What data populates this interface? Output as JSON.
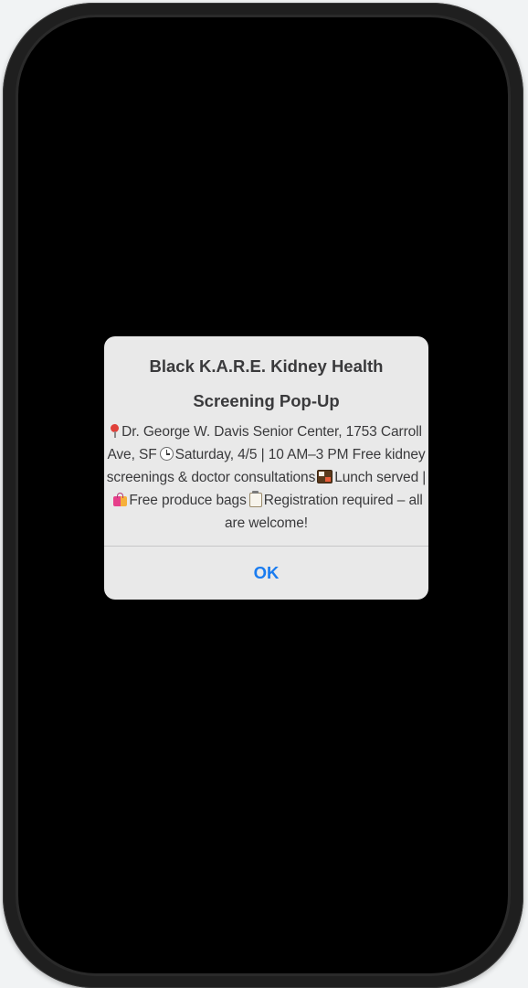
{
  "alert": {
    "title": "Black K.A.R.E. Kidney Health Screening Pop-Up",
    "message": {
      "location": "Dr. George W. Davis Senior Center, 1753 Carroll Ave, SF",
      "datetime": "Saturday, 4/5 | 10 AM–3 PM",
      "services": "Free kidney screenings & doctor consultations",
      "lunch": "Lunch served |",
      "produce": "Free produce bags",
      "registration": "Registration required – all are welcome!"
    },
    "ok_label": "OK"
  },
  "icons": {
    "location": "round-pushpin-icon",
    "time": "clock-icon",
    "lunch": "bento-box-icon",
    "produce": "shopping-bags-icon",
    "registration": "clipboard-icon"
  },
  "colors": {
    "screen_background": "#000000",
    "alert_background": "#e9e9e9",
    "text": "#3a3a3c",
    "ok_button": "#1a7cf0",
    "divider": "#c6c6c8"
  }
}
